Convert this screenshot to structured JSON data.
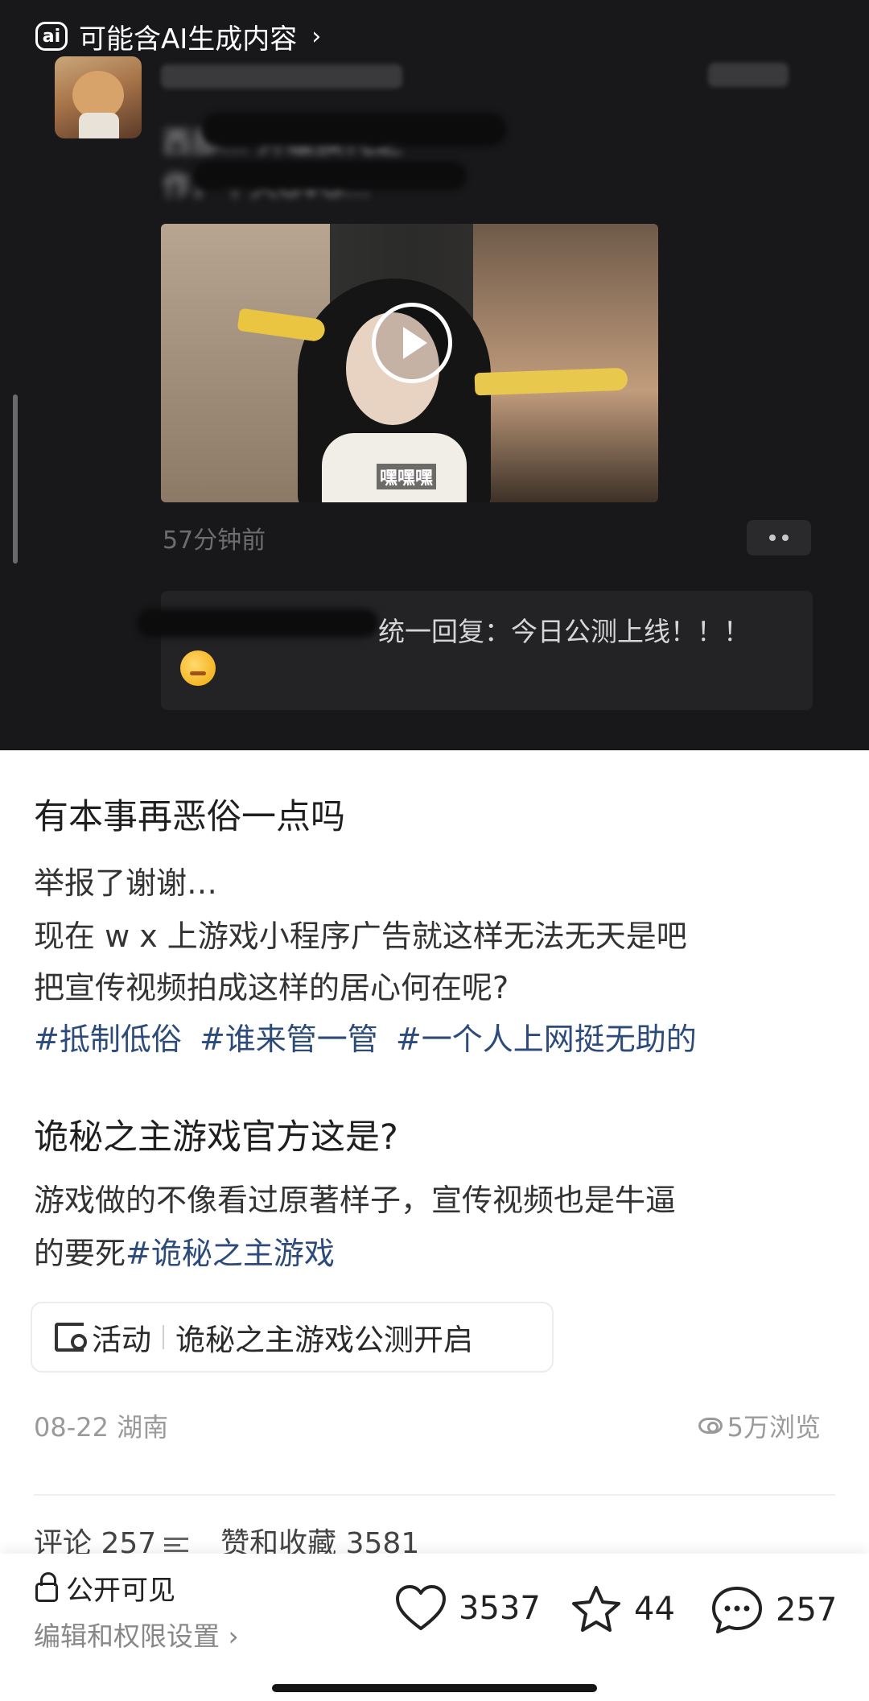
{
  "screenshot": {
    "ai_notice": "可能含AI生成内容",
    "ai_badge_label": "ai",
    "blurred_post_lines": [
      "西部... 升级换代之",
      "作，个人GVG..."
    ],
    "video_subtitle": "嘿嘿嘿",
    "time_ago": "57分钟前",
    "reply_text": "统一回复：今日公测上线！！！"
  },
  "post": {
    "title": "有本事再恶俗一点吗",
    "body_lines": [
      "举报了谢谢…",
      "现在 w x 上游戏小程序广告就这样无法无天是吧",
      "把宣传视频拍成这样的居心何在呢?"
    ],
    "tags": [
      "#抵制低俗",
      "#谁来管一管",
      "#一个人上网挺无助的"
    ],
    "title2": "诡秘之主游戏官方这是?",
    "body2_line1": "游戏做的不像看过原著样子，宣传视频也是牛逼",
    "body2_line2_text": "的要死",
    "body2_line2_tag": "#诡秘之主游戏"
  },
  "activity": {
    "label": "活动",
    "text": "诡秘之主游戏公测开启"
  },
  "meta": {
    "date_location": "08-22 湖南",
    "views": "5万浏览"
  },
  "tabs_peek": {
    "comments": "评论 257",
    "likes_collects": "赞和收藏 3581"
  },
  "bottom_bar": {
    "visibility": "公开可见",
    "settings_link": "编辑和权限设置 ›",
    "likes": "3537",
    "stars": "44",
    "comments": "257"
  }
}
